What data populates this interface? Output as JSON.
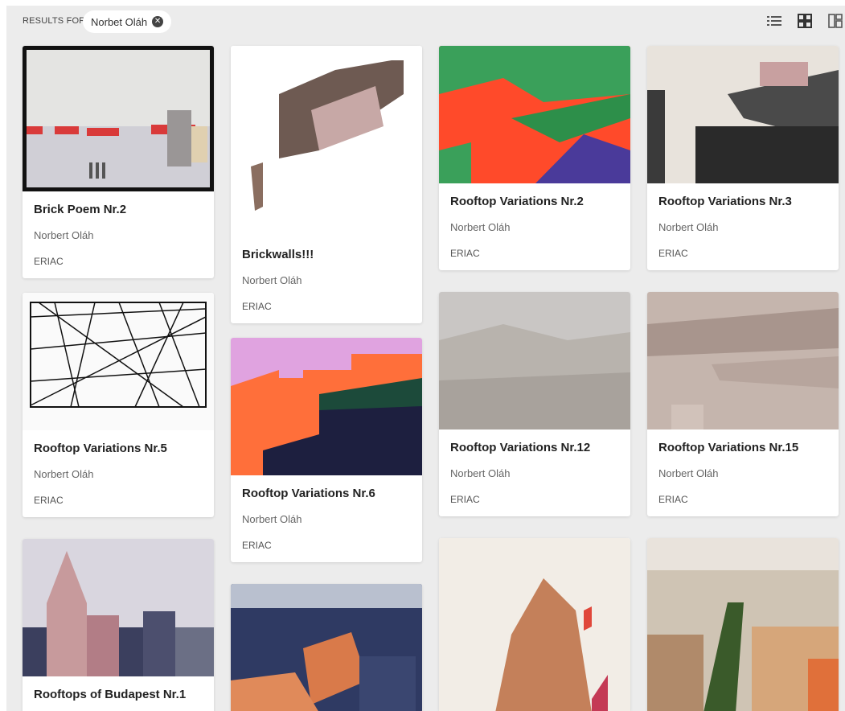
{
  "filter": {
    "results_label": "RESULTS FOR",
    "chip_label": "Norbet Oláh"
  },
  "view_toggles": [
    {
      "icon": "list-view-icon"
    },
    {
      "icon": "grid-view-icon"
    },
    {
      "icon": "masonry-view-icon"
    }
  ],
  "cards": [
    {
      "title": "Brick Poem Nr.2",
      "artist": "Norbert Oláh",
      "org": "ERIAC"
    },
    {
      "title": "Brickwalls!!!",
      "artist": "Norbert Oláh",
      "org": "ERIAC"
    },
    {
      "title": "Rooftop Variations Nr.2",
      "artist": "Norbert Oláh",
      "org": "ERIAC"
    },
    {
      "title": "Rooftop Variations Nr.3",
      "artist": "Norbert Oláh",
      "org": "ERIAC"
    },
    {
      "title": "Rooftop Variations Nr.5",
      "artist": "Norbert Oláh",
      "org": "ERIAC"
    },
    {
      "title": "Rooftop Variations Nr.6",
      "artist": "Norbert Oláh",
      "org": "ERIAC"
    },
    {
      "title": "Rooftop Variations Nr.12",
      "artist": "Norbert Oláh",
      "org": "ERIAC"
    },
    {
      "title": "Rooftop Variations Nr.15",
      "artist": "Norbert Oláh",
      "org": "ERIAC"
    },
    {
      "title": "Rooftops of Budapest Nr.1",
      "artist": "",
      "org": ""
    },
    {
      "title": "",
      "artist": "",
      "org": ""
    },
    {
      "title": "",
      "artist": "",
      "org": ""
    },
    {
      "title": "",
      "artist": "",
      "org": ""
    }
  ]
}
